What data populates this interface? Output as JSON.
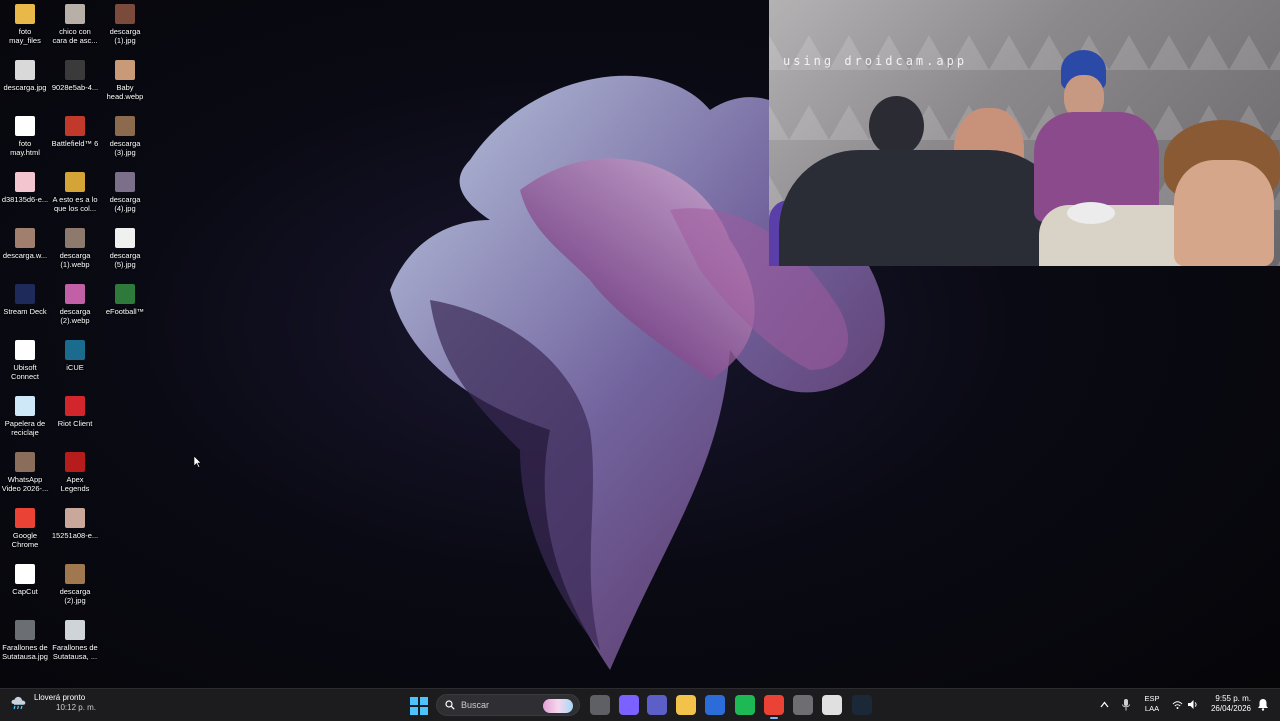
{
  "desktop": {
    "icons": [
      {
        "label": "foto\nmay_files",
        "icon": "folder-icon",
        "color": "#e8b949"
      },
      {
        "label": "descarga.jpg",
        "icon": "image-file-icon",
        "color": "#d9d9d9"
      },
      {
        "label": "foto\nmay.html",
        "icon": "chrome-html-icon",
        "color": "#ffffff"
      },
      {
        "label": "d38135d6-e...",
        "icon": "image-file-icon",
        "color": "#f3c6cf"
      },
      {
        "label": "descarga.w...",
        "icon": "image-file-icon",
        "color": "#a07f6e"
      },
      {
        "label": "Stream Deck",
        "icon": "stream-deck-icon",
        "color": "#1e2a5a"
      },
      {
        "label": "Ubisoft\nConnect",
        "icon": "ubisoft-icon",
        "color": "#ffffff"
      },
      {
        "label": "Papelera de\nreciclaje",
        "icon": "recycle-bin-icon",
        "color": "#cfe8f7"
      },
      {
        "label": "WhatsApp\nVideo 2026-...",
        "icon": "video-file-icon",
        "color": "#8a6d5a"
      },
      {
        "label": "Google\nChrome",
        "icon": "chrome-icon",
        "color": "#ea4335"
      },
      {
        "label": "CapCut",
        "icon": "capcut-icon",
        "color": "#ffffff"
      },
      {
        "label": "Farallones de\nSutatausa.jpg",
        "icon": "image-file-icon",
        "color": "#6b6f73"
      },
      {
        "label": "chico con\ncara de asc...",
        "icon": "image-file-icon",
        "color": "#b8b0a8"
      },
      {
        "label": "9028e5ab-4...",
        "icon": "image-file-icon",
        "color": "#3a3a3a"
      },
      {
        "label": "Battlefield™ 6",
        "icon": "battlefield-icon",
        "color": "#c0392b"
      },
      {
        "label": "A esto es a lo\nque los col...",
        "icon": "image-file-icon",
        "color": "#d4a437"
      },
      {
        "label": "descarga\n(1).webp",
        "icon": "image-file-icon",
        "color": "#8e7a6c"
      },
      {
        "label": "descarga\n(2).webp",
        "icon": "image-file-icon",
        "color": "#c25fa7"
      },
      {
        "label": "iCUE",
        "icon": "icue-icon",
        "color": "#1b6b8f"
      },
      {
        "label": "Riot Client",
        "icon": "riot-client-icon",
        "color": "#d3262c"
      },
      {
        "label": "Apex\nLegends",
        "icon": "apex-legends-icon",
        "color": "#b71c1c"
      },
      {
        "label": "15251a08-e...",
        "icon": "image-file-icon",
        "color": "#c9a89b"
      },
      {
        "label": "descarga\n(2).jpg",
        "icon": "image-file-icon",
        "color": "#a07850"
      },
      {
        "label": "Farallones de\nSutatausa, ...",
        "icon": "image-file-icon",
        "color": "#cfd4d8"
      },
      {
        "label": "descarga\n(1).jpg",
        "icon": "image-file-icon",
        "color": "#7a4a3a"
      },
      {
        "label": "Baby\nhead.webp",
        "icon": "image-file-icon",
        "color": "#c99a77"
      },
      {
        "label": "descarga\n(3).jpg",
        "icon": "image-file-icon",
        "color": "#8c6a4e"
      },
      {
        "label": "descarga\n(4).jpg",
        "icon": "image-file-icon",
        "color": "#7c6f8a"
      },
      {
        "label": "descarga\n(5).jpg",
        "icon": "image-file-icon",
        "color": "#f0f0f0"
      },
      {
        "label": "eFootball™",
        "icon": "efootball-icon",
        "color": "#2d7a3a"
      }
    ]
  },
  "webcam": {
    "watermark": "using droidcam.app"
  },
  "taskbar": {
    "weather": {
      "line1": "Lloverá pronto",
      "line2": "10:12 p. m."
    },
    "search_placeholder": "Buscar",
    "apps": [
      {
        "name": "file-explorer-icon",
        "color": "#5f5f66"
      },
      {
        "name": "copilot-icon",
        "color": "#7b61ff"
      },
      {
        "name": "teams-icon",
        "color": "#5b5fc7"
      },
      {
        "name": "folder-icon",
        "color": "#f2c24b"
      },
      {
        "name": "store-icon",
        "color": "#2b6cd9"
      },
      {
        "name": "spotify-icon",
        "color": "#1db954"
      },
      {
        "name": "chrome-icon",
        "color": "#ea4335"
      },
      {
        "name": "discord-like-icon",
        "color": "#6d6d72"
      },
      {
        "name": "ubisoft-icon",
        "color": "#e0e0e0"
      },
      {
        "name": "steam-icon",
        "color": "#1b2838"
      }
    ],
    "lang": {
      "line1": "ESP",
      "line2": "LAA"
    },
    "clock": {
      "time": "9:55 p. m.",
      "date": "26/04/2026"
    }
  }
}
